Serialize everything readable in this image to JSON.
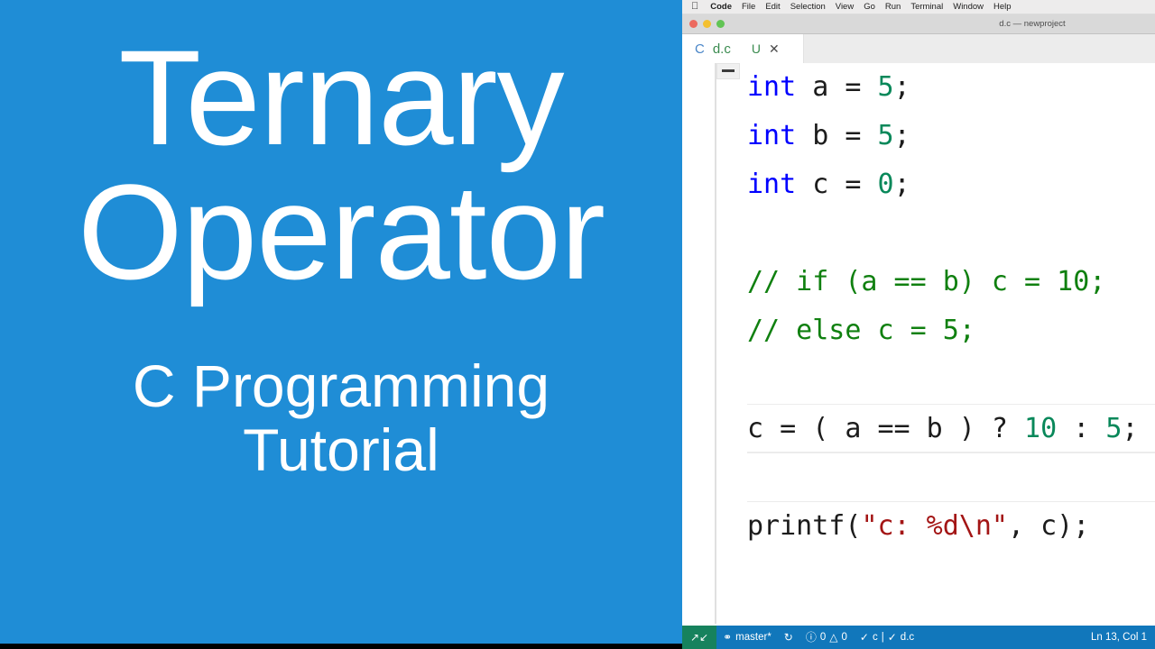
{
  "slide": {
    "background_color": "#1f8dd6",
    "title_lines": [
      "Ternary",
      "Operator"
    ],
    "subtitle_lines": [
      "C Programming",
      "Tutorial"
    ],
    "text_color": "#ffffff"
  },
  "macos_menubar": {
    "apple_logo": "apple-icon",
    "items": [
      "Code",
      "File",
      "Edit",
      "Selection",
      "View",
      "Go",
      "Run",
      "Terminal",
      "Window",
      "Help"
    ],
    "active_app": "Code"
  },
  "window": {
    "title": "d.c — newproject",
    "traffic_lights": [
      "close",
      "minimize",
      "zoom"
    ]
  },
  "tab": {
    "lang_icon": "C",
    "label": "d.c",
    "git_badge": "U",
    "close_glyph": "✕"
  },
  "editor": {
    "language": "c",
    "lines": [
      {
        "id": "line-int-a",
        "state": "normal",
        "tokens": [
          {
            "text": "int",
            "type": "kw"
          },
          {
            "text": " a = ",
            "type": "plain"
          },
          {
            "text": "5",
            "type": "num"
          },
          {
            "text": ";",
            "type": "plain"
          }
        ]
      },
      {
        "id": "line-int-b",
        "state": "normal",
        "tokens": [
          {
            "text": "int",
            "type": "kw"
          },
          {
            "text": " b = ",
            "type": "plain"
          },
          {
            "text": "5",
            "type": "num"
          },
          {
            "text": ";",
            "type": "plain"
          }
        ]
      },
      {
        "id": "line-int-c",
        "state": "normal",
        "tokens": [
          {
            "text": "int",
            "type": "kw"
          },
          {
            "text": " c = ",
            "type": "plain"
          },
          {
            "text": "0",
            "type": "num"
          },
          {
            "text": ";",
            "type": "plain"
          }
        ]
      },
      {
        "id": "line-blank-1",
        "state": "normal",
        "tokens": []
      },
      {
        "id": "line-comment-if",
        "state": "normal",
        "tokens": [
          {
            "text": "// if (a == b) c = 10;",
            "type": "comment"
          }
        ]
      },
      {
        "id": "line-comment-else",
        "state": "normal",
        "tokens": [
          {
            "text": "// else c = 5;",
            "type": "comment"
          }
        ]
      },
      {
        "id": "line-blank-2",
        "state": "normal",
        "tokens": []
      },
      {
        "id": "line-ternary",
        "state": "active",
        "tokens": [
          {
            "text": "c = ( a == b ) ? ",
            "type": "plain"
          },
          {
            "text": "10",
            "type": "num"
          },
          {
            "text": " : ",
            "type": "plain"
          },
          {
            "text": "5",
            "type": "num"
          },
          {
            "text": ";",
            "type": "plain"
          }
        ]
      },
      {
        "id": "line-blank-3",
        "state": "sep",
        "tokens": []
      },
      {
        "id": "line-printf",
        "state": "sep",
        "tokens": [
          {
            "text": "printf(",
            "type": "plain"
          },
          {
            "text": "\"c: %d\\n\"",
            "type": "str"
          },
          {
            "text": ", c);",
            "type": "plain"
          }
        ]
      }
    ]
  },
  "statusbar": {
    "remote_icon": "remote-window-icon",
    "branch_icon": "source-control-icon",
    "branch": "master*",
    "sync_icon": "sync-icon",
    "errors_icon": "error-icon",
    "errors": "0",
    "warnings_icon": "warning-icon",
    "warnings": "0",
    "check_icon": "check-icon",
    "lang_status": "c",
    "divider": "|",
    "file_status": "d.c",
    "cursor_position": "Ln 13, Col 1",
    "background_color": "#1177bb",
    "remote_color": "#16825d"
  }
}
